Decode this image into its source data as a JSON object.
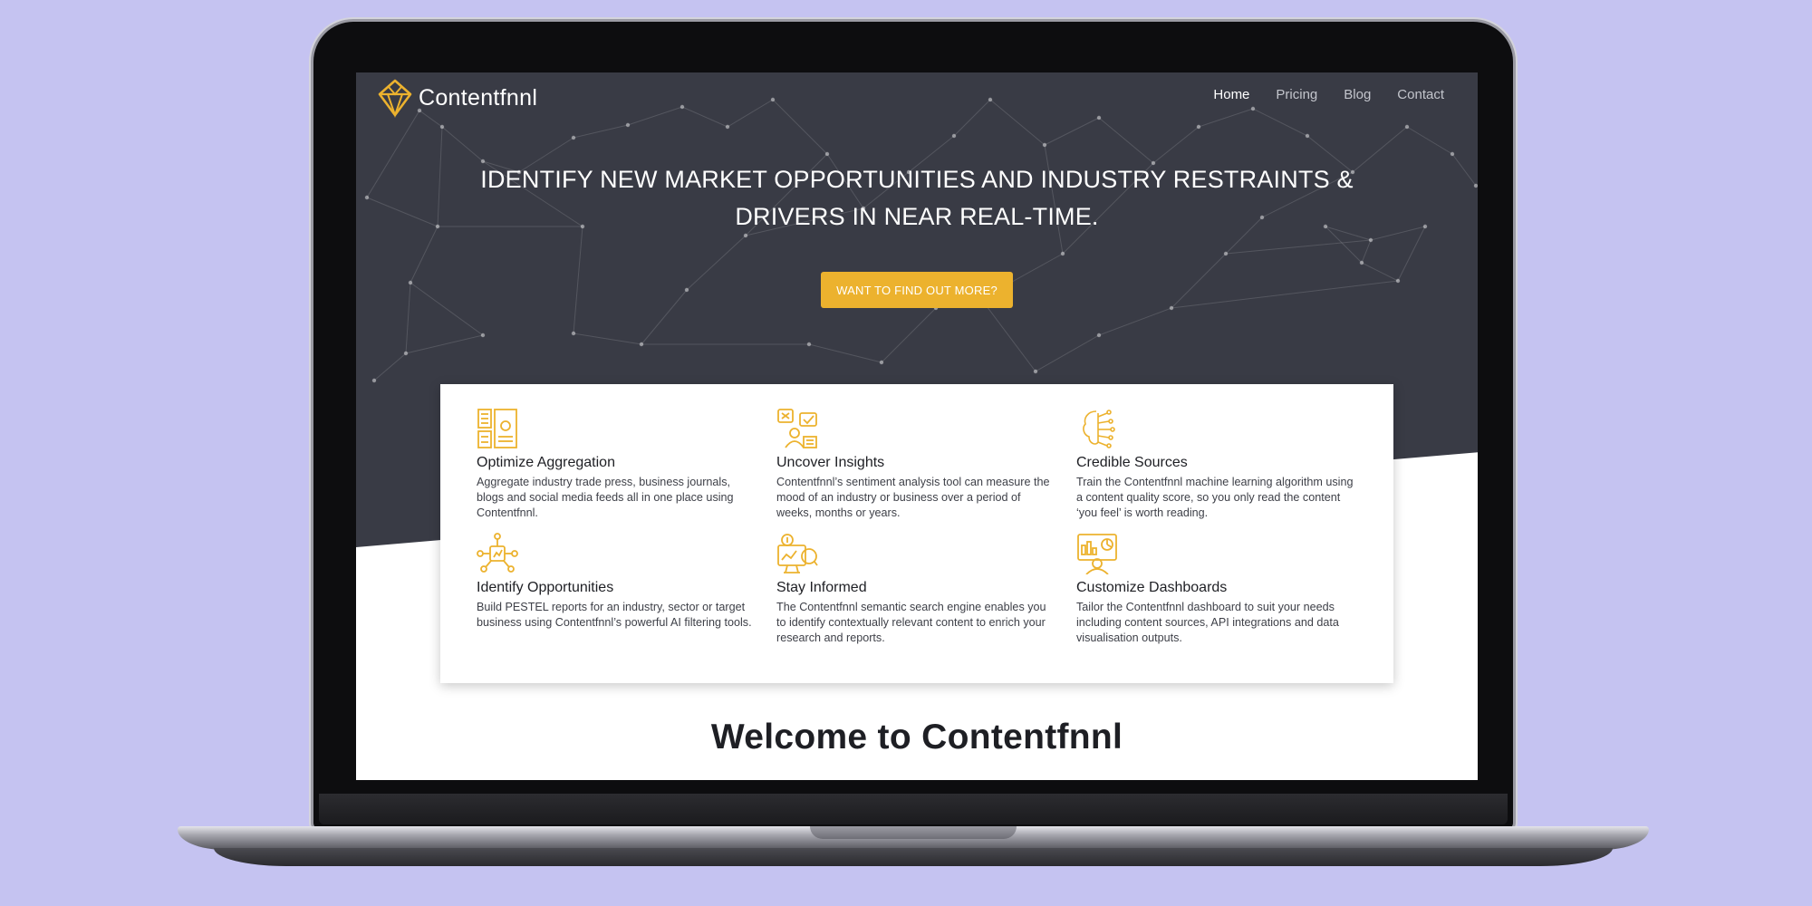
{
  "brand": {
    "name": "Contentfnnl",
    "accent": "#ecb22e",
    "hero_bg": "#393b45",
    "page_bg": "#c5c3f1"
  },
  "nav": {
    "items": [
      {
        "label": "Home",
        "active": true
      },
      {
        "label": "Pricing",
        "active": false
      },
      {
        "label": "Blog",
        "active": false
      },
      {
        "label": "Contact",
        "active": false
      }
    ]
  },
  "hero": {
    "title": "IDENTIFY NEW MARKET OPPORTUNITIES AND INDUSTRY RESTRAINTS & DRIVERS IN NEAR REAL-TIME.",
    "cta_label": "WANT TO FIND OUT MORE?"
  },
  "features": [
    {
      "icon": "aggregation-icon",
      "title": "Optimize Aggregation",
      "text": "Aggregate industry trade press, business journals, blogs and social media feeds all in one place using Contentfnnl."
    },
    {
      "icon": "insights-icon",
      "title": "Uncover Insights",
      "text": "Contentfnnl’s sentiment analysis tool can measure the mood of an industry or business over a period of weeks, months or years."
    },
    {
      "icon": "sources-icon",
      "title": "Credible Sources",
      "text": "Train the Contentfnnl machine learning algorithm using a content quality score, so you only read the content ‘you feel’ is worth reading."
    },
    {
      "icon": "opportunities-icon",
      "title": "Identify Opportunities",
      "text": "Build PESTEL reports for an industry, sector or target business using Contentfnnl’s powerful AI filtering tools."
    },
    {
      "icon": "informed-icon",
      "title": "Stay Informed",
      "text": "The Contentfnnl semantic search engine enables you to identify contextually relevant content to enrich your research and reports."
    },
    {
      "icon": "dashboard-icon",
      "title": "Customize Dashboards",
      "text": "Tailor the Contentfnnl dashboard to suit your needs including content sources, API integrations and data visualisation outputs."
    }
  ],
  "welcome": {
    "title": "Welcome to Contentfnnl"
  }
}
